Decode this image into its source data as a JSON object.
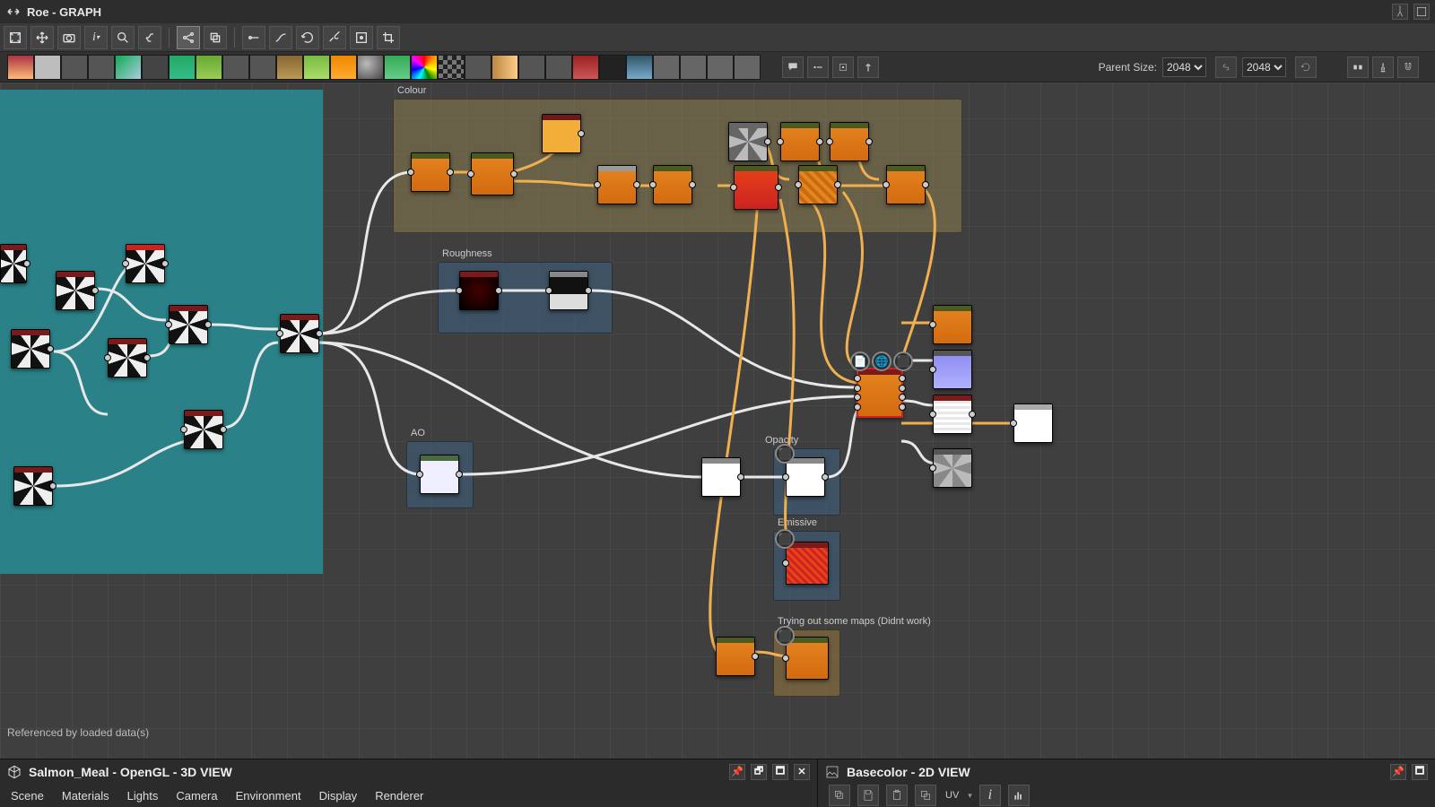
{
  "window": {
    "title": "Roe - GRAPH"
  },
  "toolbar1": {
    "items": [
      {
        "name": "fit-all-icon"
      },
      {
        "name": "move-icon"
      },
      {
        "name": "camera-icon"
      },
      {
        "name": "info-icon"
      },
      {
        "name": "zoom-icon"
      },
      {
        "name": "link-icon"
      },
      {
        "name": "share-icon",
        "active": true
      },
      {
        "name": "copy-icon"
      },
      {
        "name": "connector-dot-icon"
      },
      {
        "name": "connector-curve-icon"
      },
      {
        "name": "refresh-icon"
      },
      {
        "name": "settings-icon"
      },
      {
        "name": "frame-icon"
      },
      {
        "name": "crop-icon"
      }
    ]
  },
  "palette": {
    "items": [
      {
        "name": "pal-image",
        "bg": "linear-gradient(#a34,#fb7)"
      },
      {
        "name": "pal-solid",
        "bg": "#bdbdbd"
      },
      {
        "name": "pal-droplet",
        "bg": "#555"
      },
      {
        "name": "pal-shuffle",
        "bg": "#555"
      },
      {
        "name": "pal-curve",
        "bg": "linear-gradient(135deg,#1a5,#acd)"
      },
      {
        "name": "pal-drop2",
        "bg": "#444"
      },
      {
        "name": "pal-grid",
        "bg": "linear-gradient(#2a6,#3b8)"
      },
      {
        "name": "pal-terrain",
        "bg": "linear-gradient(#6a3,#9c5)"
      },
      {
        "name": "pal-circle",
        "bg": "#555"
      },
      {
        "name": "pal-dots",
        "bg": "#555"
      },
      {
        "name": "pal-box",
        "bg": "linear-gradient(#863,#b95)"
      },
      {
        "name": "pal-pick",
        "bg": "linear-gradient(#7b4,#ad6)"
      },
      {
        "name": "pal-orange",
        "bg": "linear-gradient(#e80,#fa3)"
      },
      {
        "name": "pal-sphere",
        "bg": "radial-gradient(circle at 35% 35%,#bbb,#444)"
      },
      {
        "name": "pal-green",
        "bg": "linear-gradient(#3a5,#6c8)"
      },
      {
        "name": "pal-rainbow",
        "bg": "conic-gradient(red,orange,yellow,green,cyan,blue,magenta,red)"
      },
      {
        "name": "pal-checker",
        "bg": "repeating-conic-gradient(#222 0 25%,#777 0 50%) 0 0/10px 10px"
      },
      {
        "name": "pal-wave",
        "bg": "#555"
      },
      {
        "name": "pal-mirror",
        "bg": "linear-gradient(90deg,#b84,#fc8)"
      },
      {
        "name": "pal-text",
        "bg": "#555"
      },
      {
        "name": "pal-transform",
        "bg": "#555"
      },
      {
        "name": "pal-diamond",
        "bg": "linear-gradient(#922,#c55)"
      },
      {
        "name": "pal-binary",
        "bg": "#222"
      },
      {
        "name": "pal-crystal",
        "bg": "linear-gradient(#356,#7ac)"
      },
      {
        "name": "pal-card1",
        "bg": "#666"
      },
      {
        "name": "pal-card2",
        "bg": "#666"
      },
      {
        "name": "pal-card3",
        "bg": "#666"
      },
      {
        "name": "pal-card4",
        "bg": "#666"
      }
    ]
  },
  "toolbar2_right": {
    "comment_items": [
      {
        "name": "speech-icon"
      },
      {
        "name": "dash-icon"
      },
      {
        "name": "target-icon"
      },
      {
        "name": "arrow-up-icon"
      }
    ],
    "parent_size_label": "Parent Size:",
    "size_w": "2048",
    "size_h": "2048",
    "extra_items": [
      {
        "name": "link-size-icon"
      },
      {
        "name": "dimension-icon"
      },
      {
        "name": "snap-icon"
      },
      {
        "name": "magnet-icon"
      }
    ]
  },
  "graph": {
    "referenced_note": "Referenced by loaded data(s)",
    "frames": {
      "colour": {
        "label": "Colour"
      },
      "roughness": {
        "label": "Roughness"
      },
      "ao": {
        "label": "AO"
      },
      "opacity": {
        "label": "Opacity"
      },
      "emissive": {
        "label": "Emissive"
      },
      "trying": {
        "label": "Trying out some maps (Didnt work)"
      }
    }
  },
  "panel3d": {
    "title": "Salmon_Meal - OpenGL - 3D VIEW",
    "menu": [
      "Scene",
      "Materials",
      "Lights",
      "Camera",
      "Environment",
      "Display",
      "Renderer"
    ]
  },
  "panel2d": {
    "title": "Basecolor - 2D VIEW",
    "uv_label": "UV"
  }
}
